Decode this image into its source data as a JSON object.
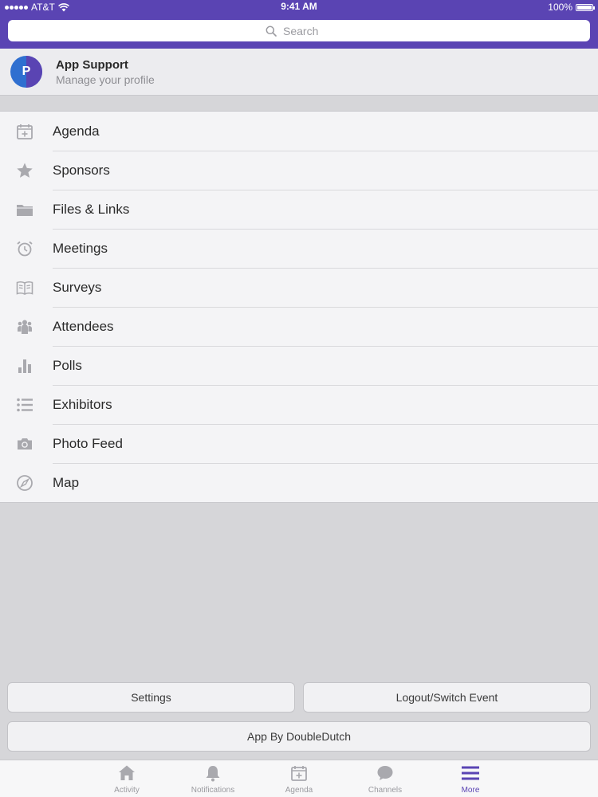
{
  "status_bar": {
    "carrier": "AT&T",
    "time": "9:41 AM",
    "battery": "100%",
    "battery_level": 1.0
  },
  "search": {
    "placeholder": "Search",
    "value": ""
  },
  "profile": {
    "avatar_letter": "P",
    "name": "App Support",
    "subtitle": "Manage your profile"
  },
  "menu": {
    "items": [
      {
        "label": "Agenda",
        "icon": "calendar-add-icon"
      },
      {
        "label": "Sponsors",
        "icon": "star-icon"
      },
      {
        "label": "Files & Links",
        "icon": "folder-icon"
      },
      {
        "label": "Meetings",
        "icon": "alarm-clock-icon"
      },
      {
        "label": "Surveys",
        "icon": "book-icon"
      },
      {
        "label": "Attendees",
        "icon": "people-icon"
      },
      {
        "label": "Polls",
        "icon": "bar-chart-icon"
      },
      {
        "label": "Exhibitors",
        "icon": "list-icon"
      },
      {
        "label": "Photo Feed",
        "icon": "camera-icon"
      },
      {
        "label": "Map",
        "icon": "compass-icon"
      }
    ]
  },
  "buttons": {
    "settings": "Settings",
    "logout": "Logout/Switch Event",
    "app_by": "App By DoubleDutch"
  },
  "tabbar": {
    "items": [
      {
        "label": "Activity",
        "icon": "house-icon",
        "active": false
      },
      {
        "label": "Notifications",
        "icon": "bell-icon",
        "active": false
      },
      {
        "label": "Agenda",
        "icon": "calendar-add-icon",
        "active": false
      },
      {
        "label": "Channels",
        "icon": "chat-bubble-icon",
        "active": false
      },
      {
        "label": "More",
        "icon": "hamburger-menu-icon",
        "active": true
      }
    ]
  },
  "colors": {
    "brand": "#5a44b3",
    "icon_gray": "#a9a9ae",
    "background": "#d6d6d9"
  }
}
